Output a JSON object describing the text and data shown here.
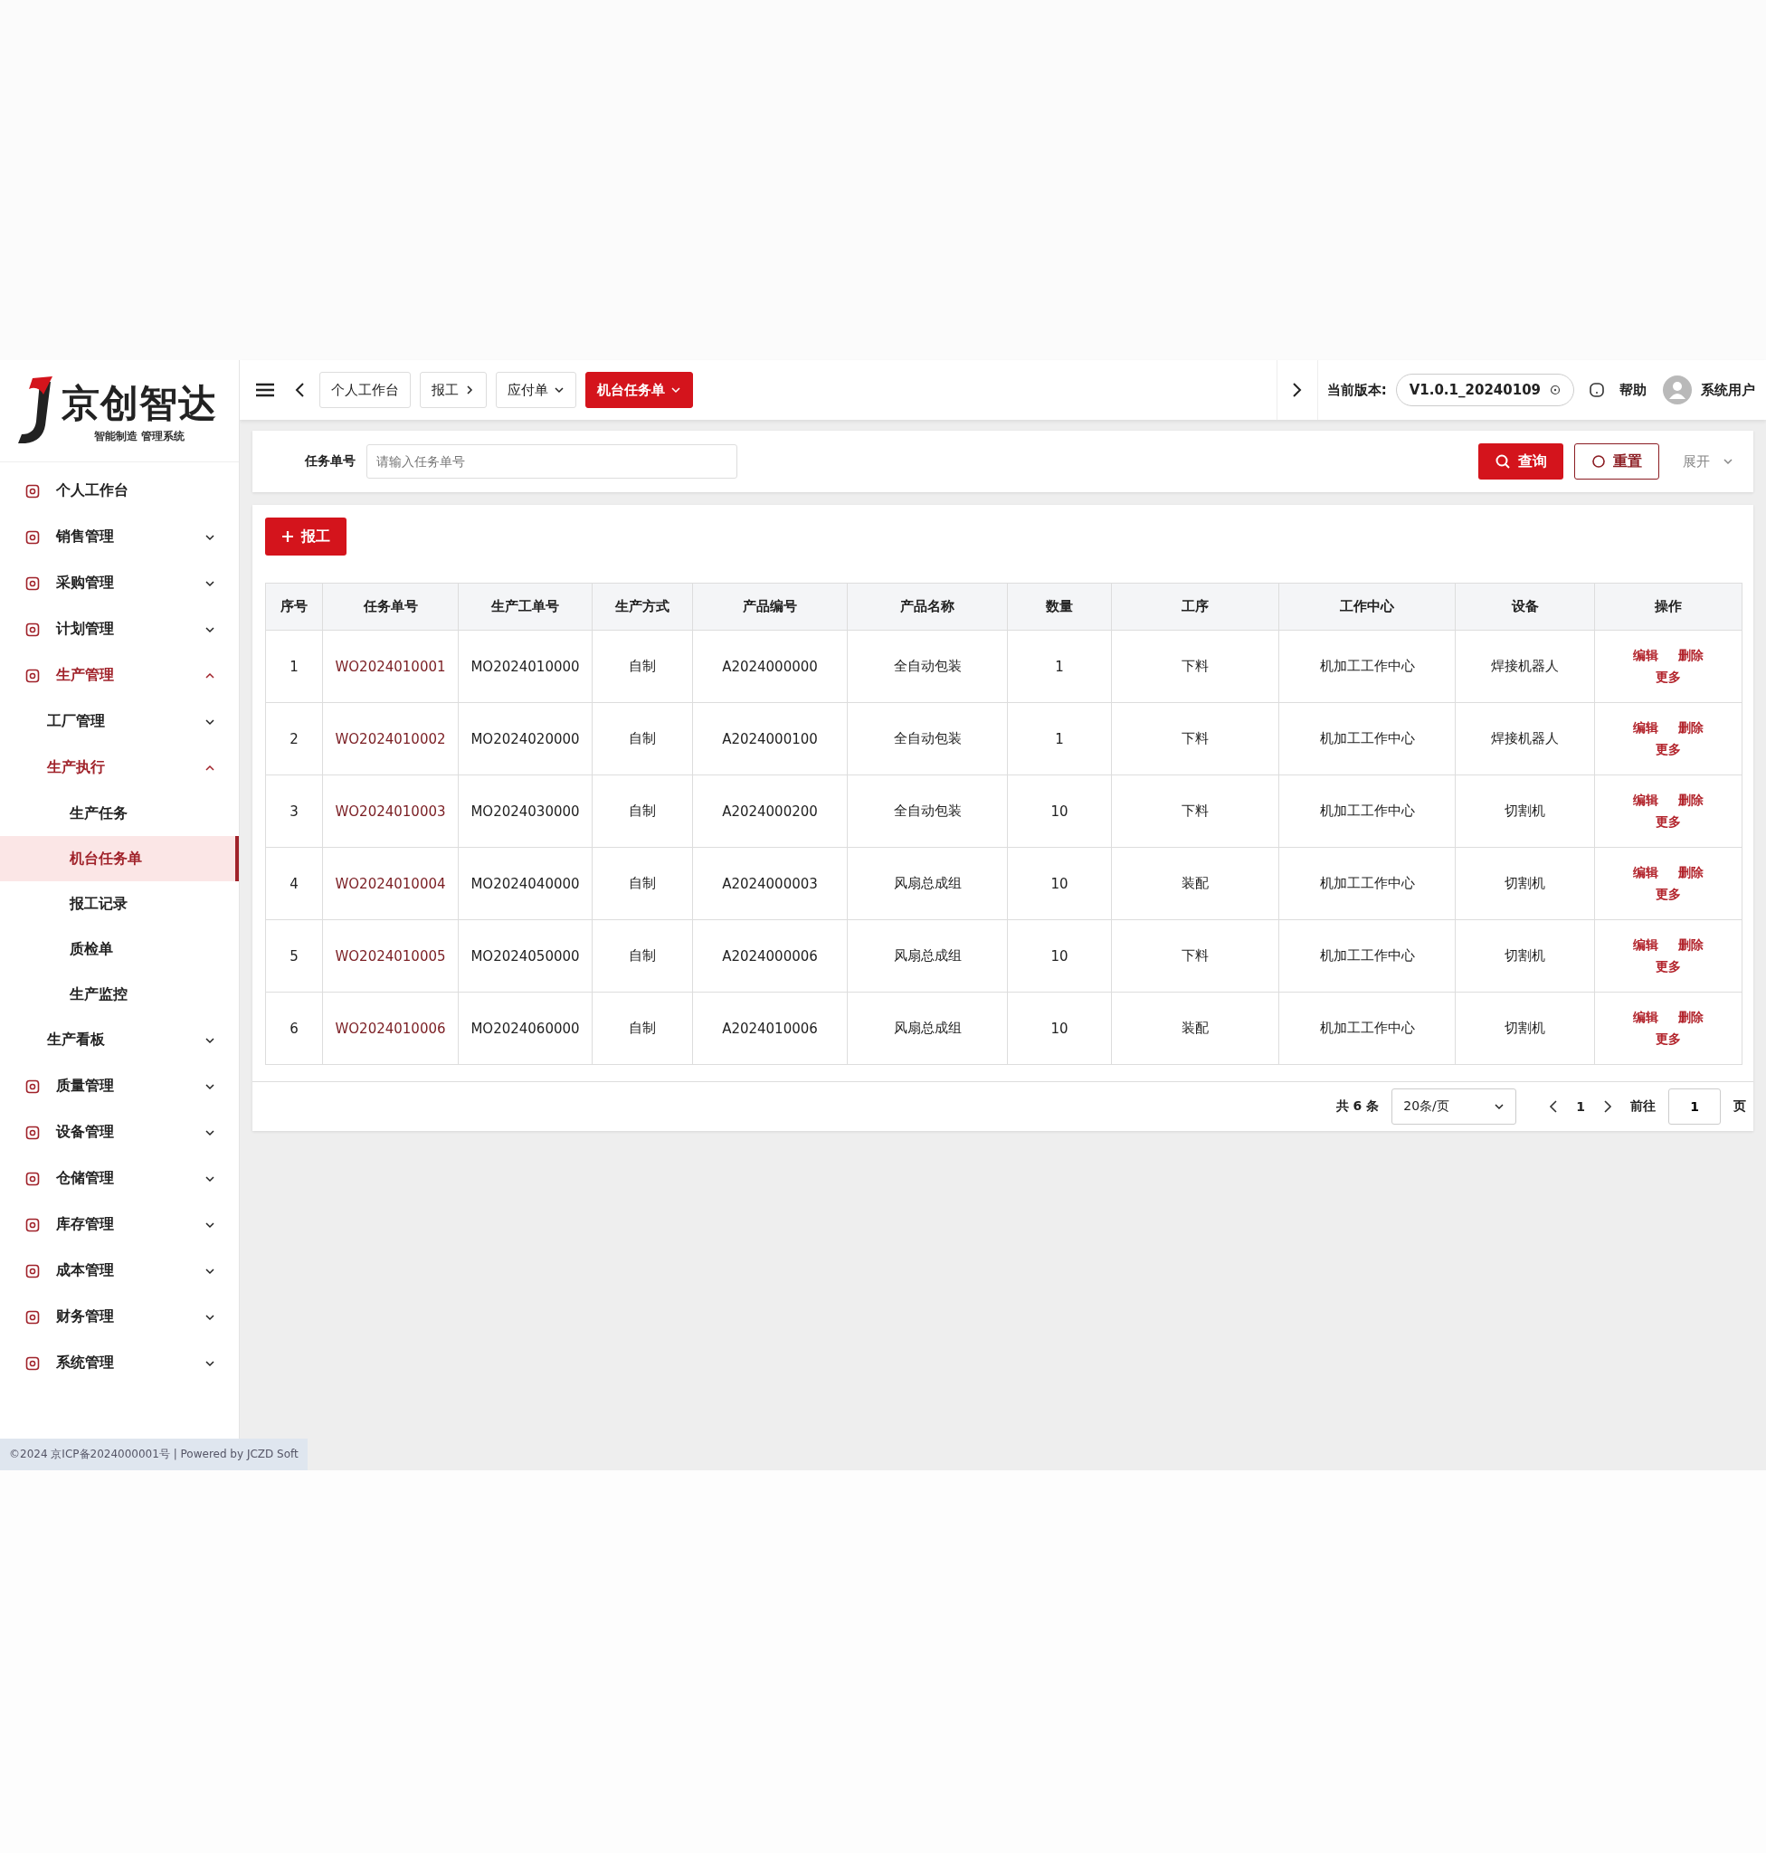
{
  "logo": {
    "name": "京创智达",
    "tagline": "智能制造 管理系统"
  },
  "sidebar": {
    "items": [
      {
        "label": "个人工作台"
      },
      {
        "label": "销售管理",
        "expanded": false
      },
      {
        "label": "采购管理",
        "expanded": false
      },
      {
        "label": "计划管理",
        "expanded": false
      },
      {
        "label": "生产管理",
        "expanded": true,
        "children": [
          {
            "label": "工厂管理",
            "expanded": false
          },
          {
            "label": "生产执行",
            "expanded": true,
            "children": [
              {
                "label": "生产任务",
                "selected": false
              },
              {
                "label": "机台任务单",
                "selected": true
              },
              {
                "label": "报工记录",
                "selected": false
              },
              {
                "label": "质检单",
                "selected": false
              },
              {
                "label": "生产监控",
                "selected": false
              }
            ]
          },
          {
            "label": "生产看板",
            "expanded": false
          }
        ]
      },
      {
        "label": "质量管理",
        "expanded": false
      },
      {
        "label": "设备管理",
        "expanded": false
      },
      {
        "label": "仓储管理",
        "expanded": false
      },
      {
        "label": "库存管理",
        "expanded": false
      },
      {
        "label": "成本管理",
        "expanded": false
      },
      {
        "label": "财务管理",
        "expanded": false
      },
      {
        "label": "系统管理",
        "expanded": false
      }
    ]
  },
  "footer": "©2024 京ICP备2024000001号 | Powered by JCZD Soft",
  "tabs": [
    {
      "label": "个人工作台",
      "selected": false
    },
    {
      "label": "报工",
      "selected": false,
      "submenu": true
    },
    {
      "label": "应付单",
      "selected": false,
      "dropdown": true
    },
    {
      "label": "机台任务单",
      "selected": true,
      "dropdown": true
    }
  ],
  "header": {
    "version_label": "当前版本:",
    "version": "V1.0.1_20240109",
    "help": "帮助",
    "user": "系统用户"
  },
  "search": {
    "label": "任务单号",
    "placeholder": "请输入任务单号",
    "query": "查询",
    "reset": "重置",
    "expand": "展开"
  },
  "add_button": "报工",
  "table": {
    "columns": [
      "序号",
      "任务单号",
      "生产工单号",
      "生产方式",
      "产品编号",
      "产品名称",
      "数量",
      "工序",
      "工作中心",
      "设备",
      "操作"
    ],
    "rows": [
      {
        "cells": [
          "1",
          "WO2024010001",
          "MO2024010000",
          "自制",
          "A2024000000",
          "全自动包装",
          "1",
          "下料",
          "机加工工作中心",
          "焊接机器人"
        ],
        "actions": [
          "编辑",
          "删除",
          "更多"
        ]
      },
      {
        "cells": [
          "2",
          "WO2024010002",
          "MO2024020000",
          "自制",
          "A2024000100",
          "全自动包装",
          "1",
          "下料",
          "机加工工作中心",
          "焊接机器人"
        ],
        "actions": [
          "编辑",
          "删除",
          "更多"
        ]
      },
      {
        "cells": [
          "3",
          "WO2024010003",
          "MO2024030000",
          "自制",
          "A2024000200",
          "全自动包装",
          "10",
          "下料",
          "机加工工作中心",
          "切割机"
        ],
        "actions": [
          "编辑",
          "删除",
          "更多"
        ]
      },
      {
        "cells": [
          "4",
          "WO2024010004",
          "MO2024040000",
          "自制",
          "A2024000003",
          "风扇总成组",
          "10",
          "装配",
          "机加工工作中心",
          "切割机"
        ],
        "actions": [
          "编辑",
          "删除",
          "更多"
        ]
      },
      {
        "cells": [
          "5",
          "WO2024010005",
          "MO2024050000",
          "自制",
          "A2024000006",
          "风扇总成组",
          "10",
          "下料",
          "机加工工作中心",
          "切割机"
        ],
        "actions": [
          "编辑",
          "删除",
          "更多"
        ]
      },
      {
        "cells": [
          "6",
          "WO2024010006",
          "MO2024060000",
          "自制",
          "A2024010006",
          "风扇总成组",
          "10",
          "装配",
          "机加工工作中心",
          "切割机"
        ],
        "actions": [
          "编辑",
          "删除",
          "更多"
        ]
      }
    ]
  },
  "pagination": {
    "total": "共 6 条",
    "page_size": "20条/页",
    "page": "1",
    "goto_label": "前往",
    "goto_value": "1",
    "page_unit": "页"
  }
}
